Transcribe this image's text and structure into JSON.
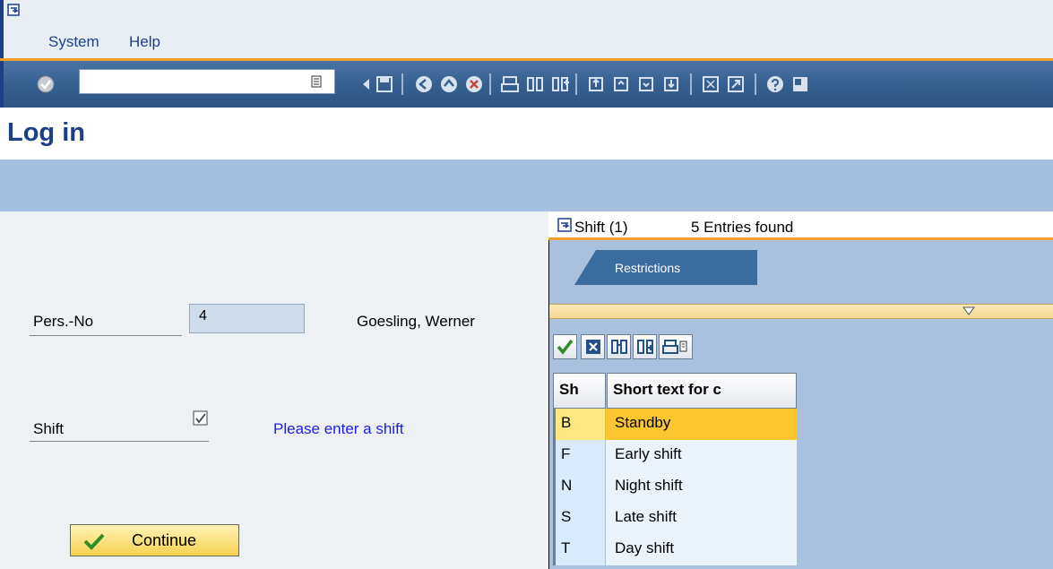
{
  "menu": {
    "items": [
      {
        "label": "System"
      },
      {
        "label": "Help"
      }
    ]
  },
  "toolbar": {
    "okcode_value": ""
  },
  "page": {
    "title": "Log in"
  },
  "form": {
    "persno_label": "Pers.-No",
    "persno_value": "4",
    "employee_name": "Goesling, Werner",
    "shift_label": "Shift",
    "shift_hint": "Please enter a shift",
    "continue_label": "Continue"
  },
  "popup": {
    "title": "Shift (1)",
    "count": "5 Entries found",
    "tab": "Restrictions",
    "columns": [
      "Sh",
      "Short text for c"
    ],
    "rows": [
      {
        "key": "B",
        "text": "Standby",
        "selected": true
      },
      {
        "key": "F",
        "text": "Early shift"
      },
      {
        "key": "N",
        "text": "Night shift"
      },
      {
        "key": "S",
        "text": "Late shift"
      },
      {
        "key": "T",
        "text": "Day shift"
      }
    ]
  },
  "colors": {
    "accent": "#f0a02e",
    "title": "#1d3f86",
    "hint": "#1b1ee8",
    "selected_row": "#fbc62f"
  }
}
